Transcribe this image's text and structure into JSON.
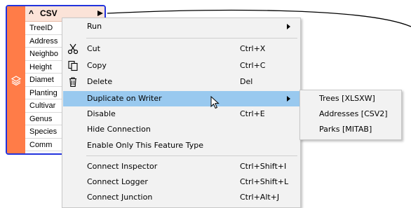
{
  "node": {
    "collapse_caret": "^",
    "title": "CSV",
    "attributes": [
      "TreeID",
      "Address",
      "Neighbo",
      "Height",
      "Diamet",
      "Planting",
      "Cultivar",
      "Genus",
      "Species",
      "Comm"
    ]
  },
  "context_menu": {
    "items": [
      {
        "label": "Run",
        "shortcut": "",
        "submenu": true,
        "icon": ""
      },
      {
        "label": "Cut",
        "shortcut": "Ctrl+X",
        "submenu": false,
        "icon": "scissors-icon"
      },
      {
        "label": "Copy",
        "shortcut": "Ctrl+C",
        "submenu": false,
        "icon": "copy-icon"
      },
      {
        "label": "Delete",
        "shortcut": "Del",
        "submenu": false,
        "icon": "trash-icon"
      },
      {
        "label": "Duplicate on Writer",
        "shortcut": "",
        "submenu": true,
        "highlighted": true
      },
      {
        "label": "Disable",
        "shortcut": "Ctrl+E",
        "submenu": false
      },
      {
        "label": "Hide Connection",
        "shortcut": "",
        "submenu": false
      },
      {
        "label": "Enable Only This Feature Type",
        "shortcut": "",
        "submenu": false
      },
      {
        "label": "Connect Inspector",
        "shortcut": "Ctrl+Shift+I",
        "submenu": false
      },
      {
        "label": "Connect Logger",
        "shortcut": "Ctrl+Shift+L",
        "submenu": false
      },
      {
        "label": "Connect Junction",
        "shortcut": "Ctrl+Alt+J",
        "submenu": false
      }
    ]
  },
  "submenu": {
    "items": [
      "Trees [XLSXW]",
      "Addresses [CSV2]",
      "Parks [MITAB]"
    ]
  },
  "colors": {
    "node_strip": "#ff7c48",
    "node_border": "#2233dd",
    "menu_highlight": "#99c9ef",
    "menu_background": "#f2f2f2"
  }
}
